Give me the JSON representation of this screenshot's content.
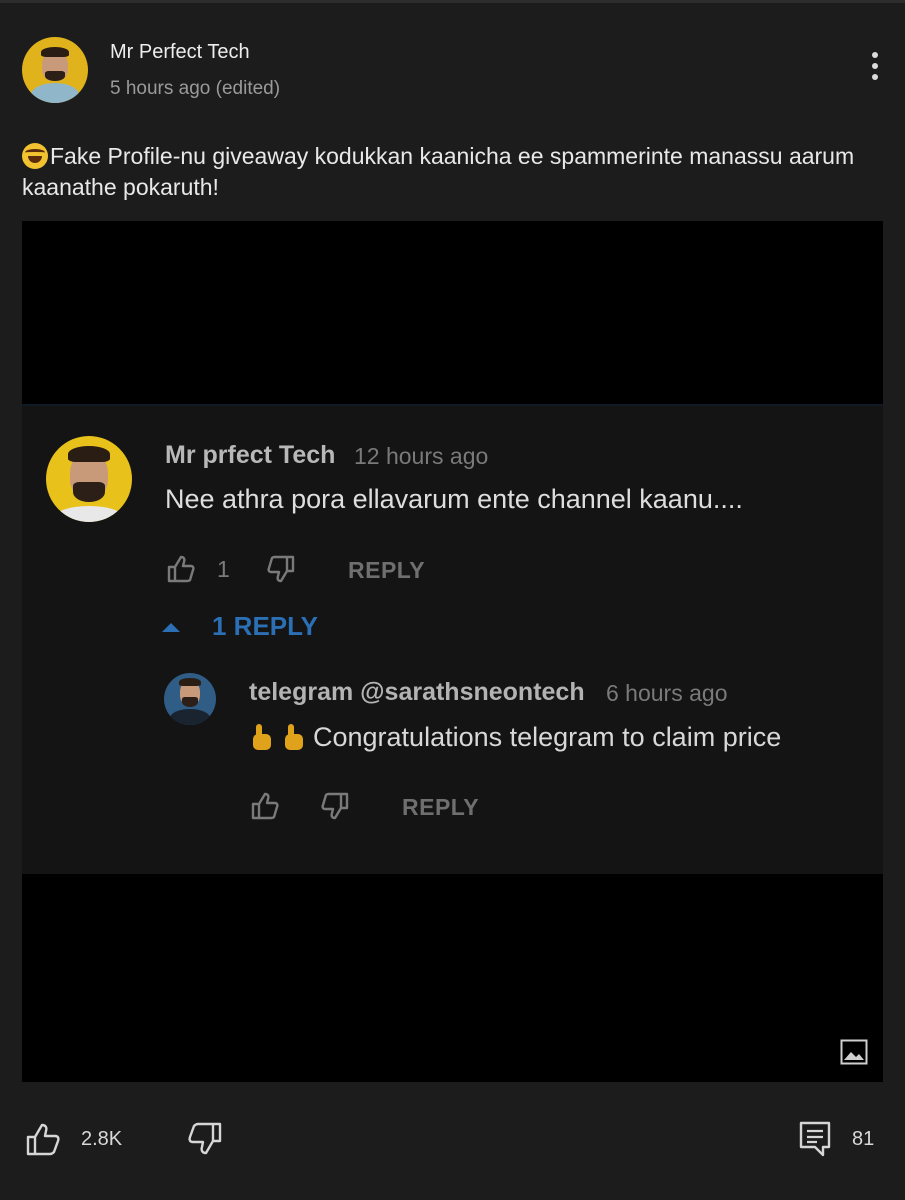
{
  "post": {
    "channel_name": "Mr Perfect Tech",
    "timestamp": "5 hours ago (edited)",
    "text": "Fake Profile-nu giveaway kodukkan kaanicha ee spammerinte manassu aarum kaanathe pokaruth!",
    "emoji": "rolling-on-floor-laughing"
  },
  "screenshot": {
    "comment": {
      "author": "Mr prfect Tech",
      "time": "12 hours ago",
      "text": "Nee athra pora ellavarum ente channel kaanu....",
      "likes": "1",
      "reply_label": "REPLY"
    },
    "replies_toggle": "1 REPLY",
    "reply": {
      "author": "telegram @sarathsneontech",
      "time": "6 hours ago",
      "text": "Congratulations telegram to claim price",
      "reply_label": "REPLY"
    }
  },
  "actions": {
    "like_count": "2.8K",
    "comment_count": "81"
  },
  "colors": {
    "background": "#1c1c1c",
    "link_blue": "#2b6fb5",
    "avatar_yellow": "#e0b31c"
  }
}
